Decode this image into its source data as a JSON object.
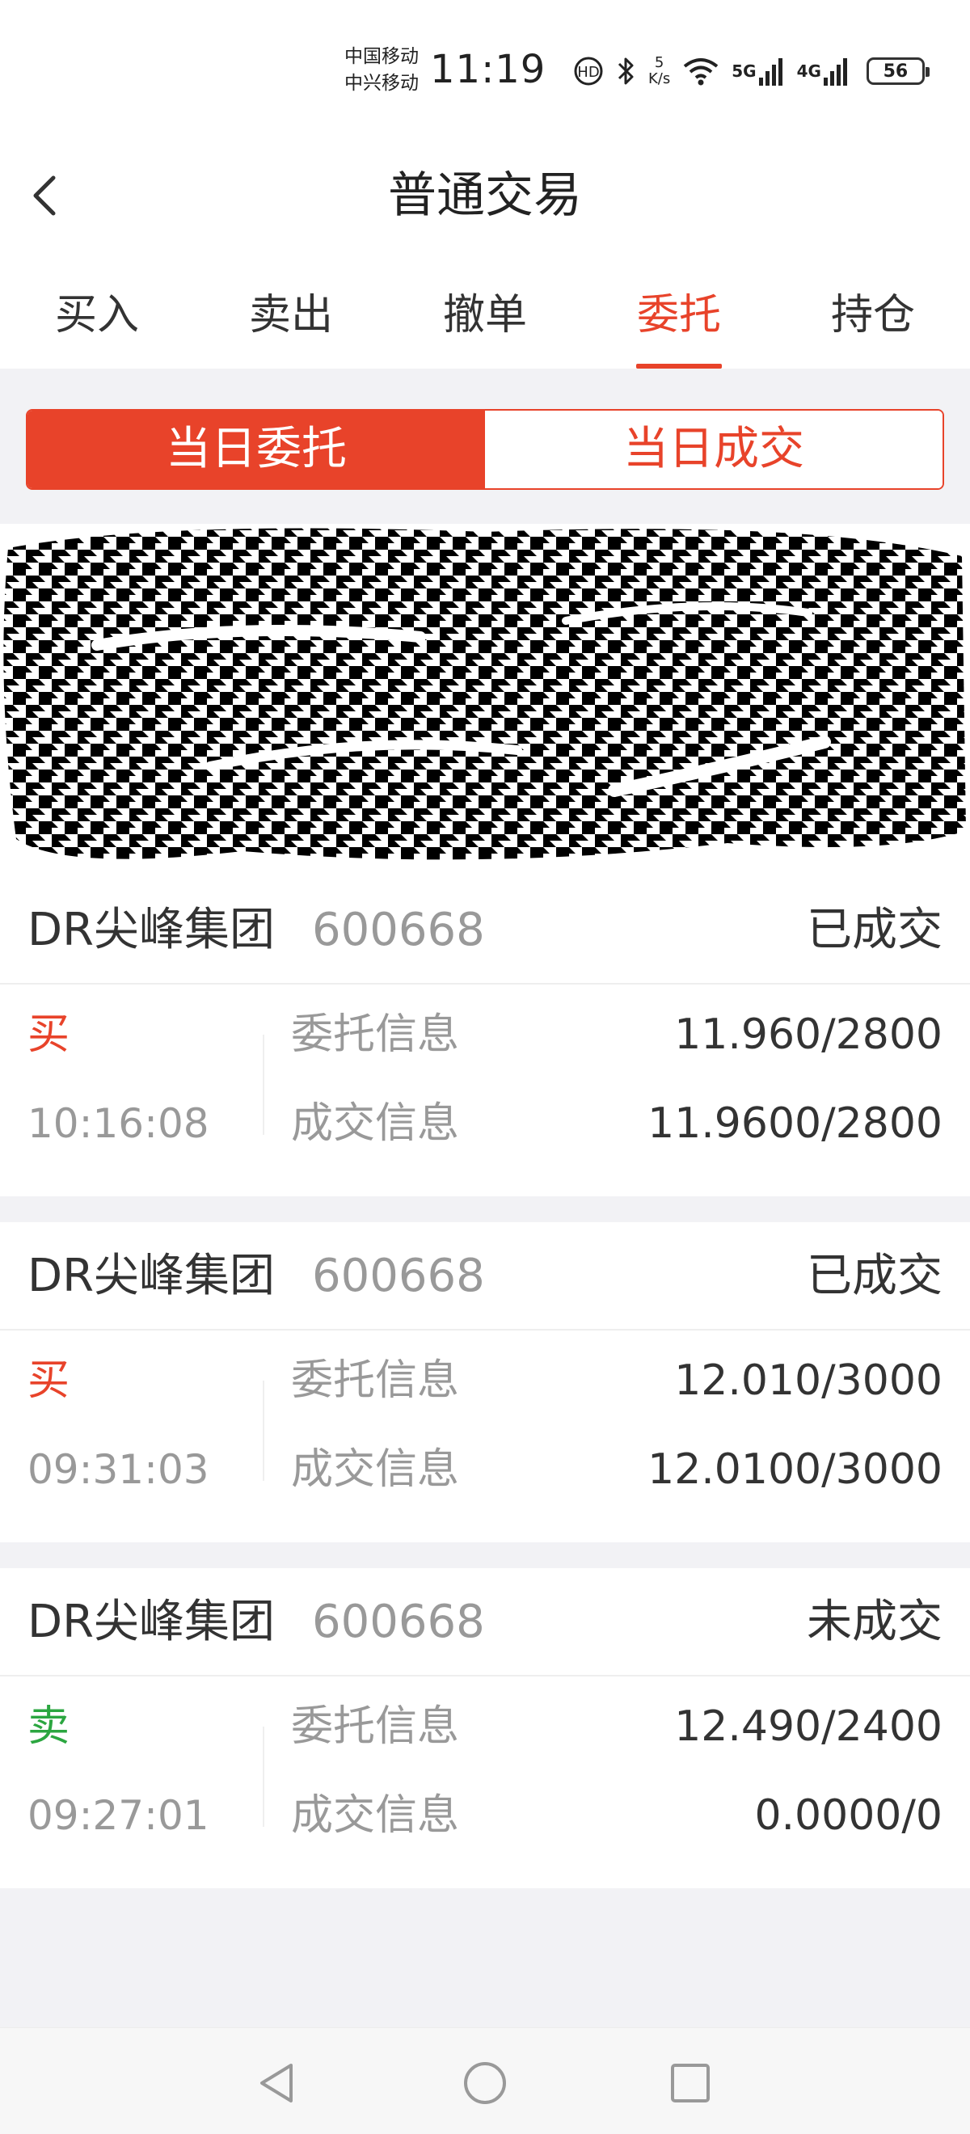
{
  "status_bar": {
    "carrier_1": "中国移动",
    "carrier_2": "中兴移动",
    "time": "11:19",
    "speed_value": "5",
    "speed_unit": "K/s",
    "net_5g": "5G",
    "net_4g": "4G",
    "battery": "56"
  },
  "header": {
    "title": "普通交易"
  },
  "tabs": [
    {
      "label": "买入"
    },
    {
      "label": "卖出"
    },
    {
      "label": "撤单"
    },
    {
      "label": "委托",
      "active": true
    },
    {
      "label": "持仓"
    }
  ],
  "segment": {
    "left": "当日委托",
    "right": "当日成交",
    "active": "left"
  },
  "orders": [
    {
      "name": "DR尖峰集团",
      "code": "600668",
      "status": "已成交",
      "side": "买",
      "time": "10:16:08",
      "order_label": "委托信息",
      "order_value": "11.960/2800",
      "fill_label": "成交信息",
      "fill_value": "11.9600/2800"
    },
    {
      "name": "DR尖峰集团",
      "code": "600668",
      "status": "已成交",
      "side": "买",
      "time": "09:31:03",
      "order_label": "委托信息",
      "order_value": "12.010/3000",
      "fill_label": "成交信息",
      "fill_value": "12.0100/3000"
    },
    {
      "name": "DR尖峰集团",
      "code": "600668",
      "status": "未成交",
      "side": "卖",
      "time": "09:27:01",
      "order_label": "委托信息",
      "order_value": "12.490/2400",
      "fill_label": "成交信息",
      "fill_value": "0.0000/0"
    }
  ],
  "colors": {
    "accent": "#e8432a",
    "buy": "#e8432a",
    "sell": "#2ba640",
    "muted": "#999999"
  },
  "icons": {
    "back": "chevron-left-icon",
    "nav_back": "triangle-back-icon",
    "nav_home": "circle-home-icon",
    "nav_recent": "square-recent-icon"
  }
}
